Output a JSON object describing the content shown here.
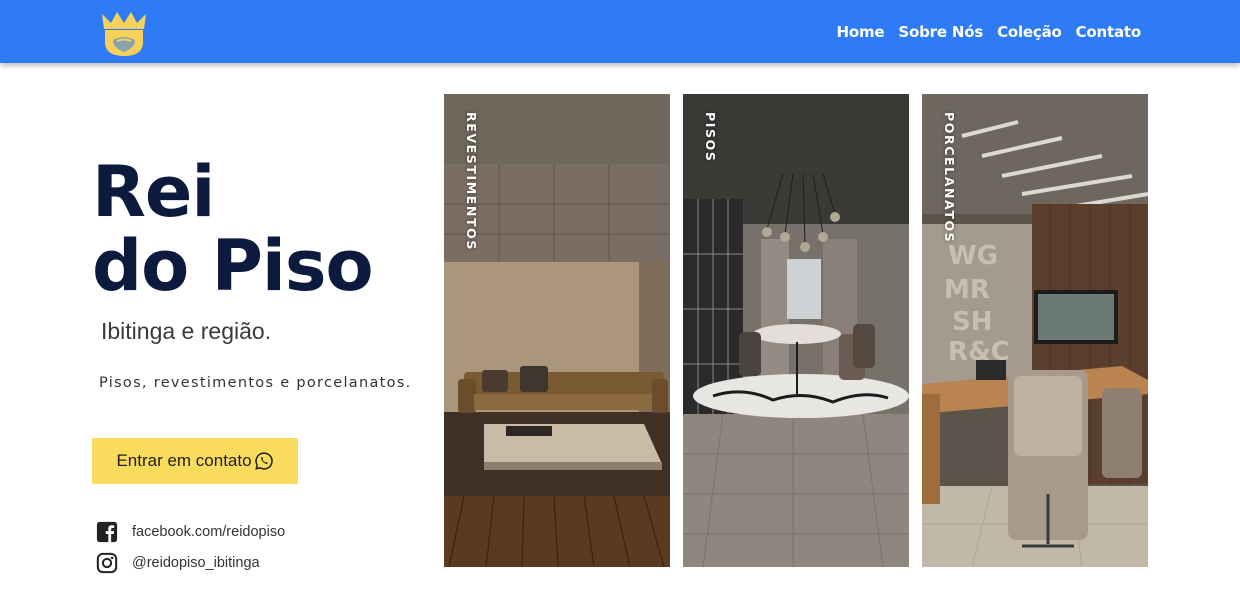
{
  "header": {
    "logo_icon": "crown-bearded-king-icon",
    "background_color": "#2f7bf6",
    "nav": [
      {
        "label": "Home"
      },
      {
        "label": "Sobre Nós"
      },
      {
        "label": "Coleção"
      },
      {
        "label": "Contato"
      }
    ]
  },
  "hero": {
    "title_line1": "Rei",
    "title_line2": "do Piso",
    "subtitle": "Ibitinga e região.",
    "description": "Pisos, revestimentos e porcelanatos.",
    "cta_label": "Entrar em contato",
    "cta_icon": "whatsapp-icon",
    "cta_color": "#fadb5c",
    "title_color": "#0c1a3d"
  },
  "social": {
    "facebook": {
      "icon": "facebook-icon",
      "text": "facebook.com/reidopiso"
    },
    "instagram": {
      "icon": "instagram-icon",
      "text": "@reidopiso_ibitinga"
    }
  },
  "categories": [
    {
      "label": "REVESTIMENTOS",
      "image": "living-room-with-sofa-photo"
    },
    {
      "label": "PISOS",
      "image": "dining-room-with-table-photo"
    },
    {
      "label": "PORCELANATOS",
      "image": "office-with-desk-photo"
    }
  ]
}
